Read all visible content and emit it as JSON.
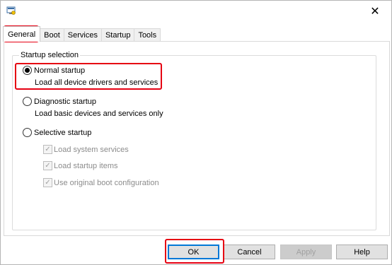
{
  "window": {
    "icon": "msconfig-icon",
    "close_glyph": "✕"
  },
  "tabs": [
    {
      "label": "General",
      "active": true
    },
    {
      "label": "Boot"
    },
    {
      "label": "Services"
    },
    {
      "label": "Startup"
    },
    {
      "label": "Tools"
    }
  ],
  "startup_selection": {
    "title": "Startup selection",
    "normal": {
      "label": "Normal startup",
      "description": "Load all device drivers and services",
      "checked": true
    },
    "diagnostic": {
      "label": "Diagnostic startup",
      "description": "Load basic devices and services only",
      "checked": false
    },
    "selective": {
      "label": "Selective startup",
      "checked": false,
      "options": [
        {
          "label": "Load system services",
          "checked": true,
          "enabled": false
        },
        {
          "label": "Load startup items",
          "checked": true,
          "enabled": false
        },
        {
          "label": "Use original boot configuration",
          "checked": true,
          "enabled": false
        }
      ]
    }
  },
  "buttons": {
    "ok": "OK",
    "cancel": "Cancel",
    "apply": "Apply",
    "help": "Help"
  },
  "highlight_color": "#e60012",
  "accent_color": "#0078d7"
}
